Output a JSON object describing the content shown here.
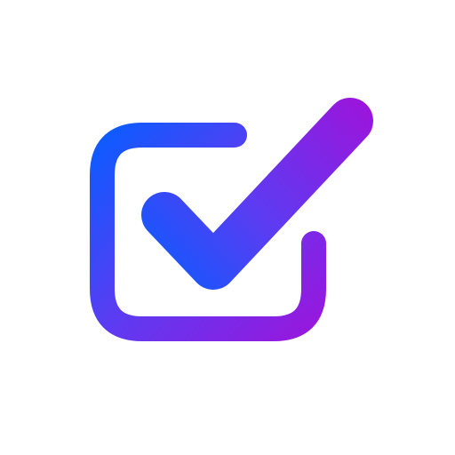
{
  "icon": {
    "name": "checkbox-checkmark-icon",
    "background_color": "#ffffff",
    "gradient_start": "#0a5cff",
    "gradient_mid": "#5b3cf2",
    "gradient_end": "#9a16dc"
  }
}
